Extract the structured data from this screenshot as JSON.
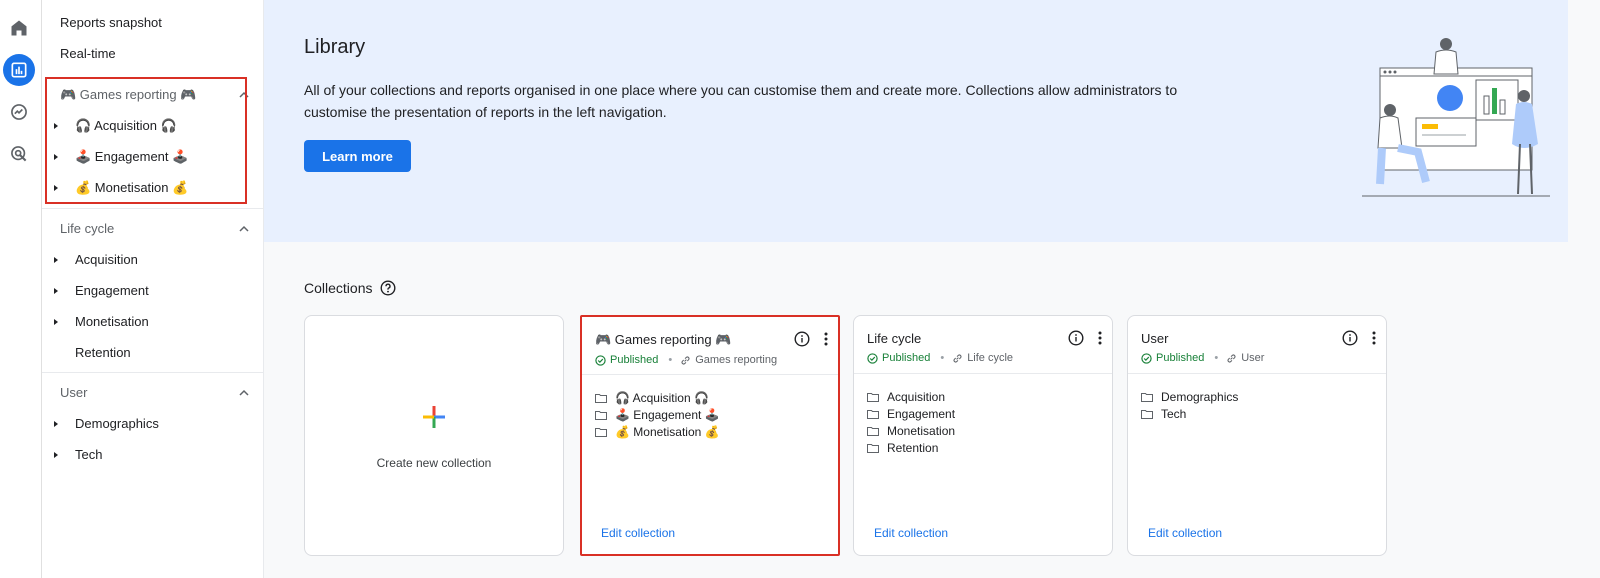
{
  "sidebar": {
    "top_items": [
      "Reports snapshot",
      "Real-time"
    ],
    "sections": [
      {
        "title": "🎮 Games reporting 🎮",
        "items": [
          {
            "label": "🎧 Acquisition 🎧",
            "expandable": true
          },
          {
            "label": "🕹️ Engagement 🕹️",
            "expandable": true
          },
          {
            "label": "💰 Monetisation 💰",
            "expandable": true
          }
        ]
      },
      {
        "title": "Life cycle",
        "items": [
          {
            "label": "Acquisition",
            "expandable": true
          },
          {
            "label": "Engagement",
            "expandable": true
          },
          {
            "label": "Monetisation",
            "expandable": true
          },
          {
            "label": "Retention",
            "expandable": false
          }
        ]
      },
      {
        "title": "User",
        "items": [
          {
            "label": "Demographics",
            "expandable": true
          },
          {
            "label": "Tech",
            "expandable": true
          }
        ]
      }
    ]
  },
  "rail_icons": [
    "home-icon",
    "reports-icon",
    "explore-icon",
    "advertising-icon"
  ],
  "hero": {
    "title": "Library",
    "description": "All of your collections and reports organised in one place where you can customise them and create more. Collections allow administrators to customise the presentation of reports in the left navigation.",
    "button": "Learn more"
  },
  "collections": {
    "title": "Collections",
    "create_label": "Create new collection",
    "cards": [
      {
        "title": "🎮 Games reporting 🎮",
        "status": "Published",
        "linked": "Games reporting",
        "items": [
          "🎧 Acquisition 🎧",
          "🕹️ Engagement 🕹️",
          "💰 Monetisation 💰"
        ],
        "edit": "Edit collection"
      },
      {
        "title": "Life cycle",
        "status": "Published",
        "linked": "Life cycle",
        "items": [
          "Acquisition",
          "Engagement",
          "Monetisation",
          "Retention"
        ],
        "edit": "Edit collection"
      },
      {
        "title": "User",
        "status": "Published",
        "linked": "User",
        "items": [
          "Demographics",
          "Tech"
        ],
        "edit": "Edit collection"
      }
    ]
  },
  "colors": {
    "accent": "#1a73e8",
    "highlight": "#d93025",
    "published": "#188038",
    "hero_bg": "#e8f0fe"
  }
}
